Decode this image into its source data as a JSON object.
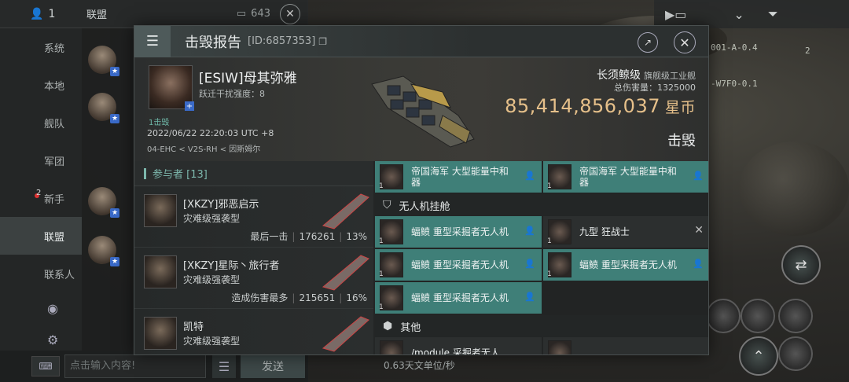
{
  "chat": {
    "people_count": "1",
    "title": "联盟",
    "count": "643",
    "tabs": [
      {
        "label": "系统"
      },
      {
        "label": "本地"
      },
      {
        "label": "舰队"
      },
      {
        "label": "军团"
      },
      {
        "label": "新手",
        "badge": "2"
      },
      {
        "label": "联盟",
        "active": true
      },
      {
        "label": "联系人"
      }
    ],
    "input_placeholder": "点击输入内容!",
    "send_label": "发送"
  },
  "hud": {
    "text_1": "001-A-0.4",
    "text_2": "-W7F0-0.1",
    "badge": "2",
    "speed": "0.63天文单位/秒"
  },
  "report": {
    "title": "击毁报告",
    "id": "[ID:6857353]",
    "victim": {
      "name": "[ESIW]母其弥雅",
      "warp_strength": "跃迁干扰强度：8",
      "kills": "1击毁",
      "time": "2022/06/22 22:20:03 UTC +8",
      "location": "04-EHC < V2S-RH < 因斯姆尔"
    },
    "ship": {
      "name": "长须鲸级",
      "class": "旗舰级工业舰",
      "total_damage": "总伤害量：1325000",
      "isk_value": "85,414,856,037",
      "currency": "星币",
      "status": "击毁"
    },
    "participants": {
      "label": "参与者 [13]",
      "rows": [
        {
          "name": "[XKZY]邪恶启示",
          "ship": "灾难级强袭型",
          "tag": "最后一击",
          "damage": "176261",
          "percent": "13%"
        },
        {
          "name": "[XKZY]星际丶旅行者",
          "ship": "灾难级强袭型",
          "tag": "造成伤害最多",
          "damage": "215651",
          "percent": "16%"
        },
        {
          "name": "凯特",
          "ship": "灾难级强袭型",
          "tag": "",
          "damage": "",
          "percent": ""
        }
      ]
    },
    "items": {
      "top_row": [
        {
          "name": "帝国海军 大型能量中和器",
          "qty": "1"
        },
        {
          "name": "帝国海军 大型能量中和器",
          "qty": "1"
        }
      ],
      "drone_section": "无人机挂舱",
      "drones": [
        {
          "name": "蝠鲼 重型采掘者无人机",
          "qty": "1",
          "style": "teal"
        },
        {
          "name": "九型 狂战士",
          "qty": "1",
          "style": "dark"
        },
        {
          "name": "蝠鲼 重型采掘者无人机",
          "qty": "1",
          "style": "teal"
        },
        {
          "name": "蝠鲼 重型采掘者无人机",
          "qty": "1",
          "style": "teal"
        },
        {
          "name": "蝠鲼 重型采掘者无人机",
          "qty": "1",
          "style": "teal"
        }
      ],
      "other_section": "其他",
      "other_partial": "/module 采掘者无人"
    }
  },
  "colors": {
    "teal_item": "#3f7f78",
    "accent_teal": "#7db8ad",
    "isk_gold": "#e6c08a"
  }
}
